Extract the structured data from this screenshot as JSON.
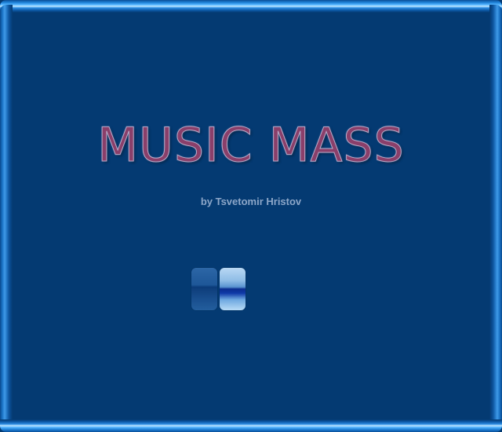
{
  "game": {
    "title": "MUSIC MASS",
    "subtitle": "by Tsvetomir Hristov"
  },
  "loader": {
    "icon": "equalizer-icon",
    "columns": 2,
    "active_column": 2
  },
  "colors": {
    "background": "#043a72",
    "bezel_highlight": "#52b4ff",
    "title_fill": "#8a3f6a",
    "title_outline": "#b9a8c8",
    "subtitle": "#8da7c9"
  }
}
